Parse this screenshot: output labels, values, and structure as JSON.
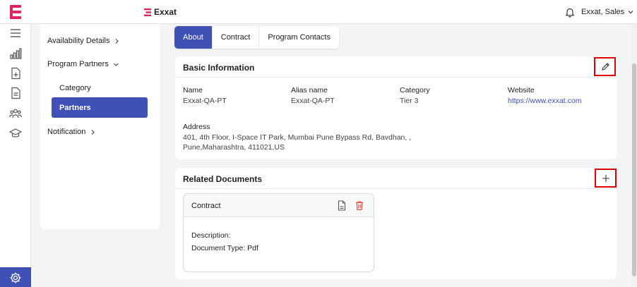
{
  "header": {
    "brand": "Exxat",
    "user": "Exxat, Sales"
  },
  "nav": {
    "availability": "Availability Details",
    "program_partners": "Program Partners",
    "category": "Category",
    "partners": "Partners",
    "notification": "Notification"
  },
  "tabs": [
    "About",
    "Contract",
    "Program Contacts"
  ],
  "basic": {
    "title": "Basic Information",
    "fields": [
      {
        "label": "Name",
        "value": "Exxat-QA-PT"
      },
      {
        "label": "Alias name",
        "value": "Exxat-QA-PT"
      },
      {
        "label": "Category",
        "value": "Tier 3"
      },
      {
        "label": "Website",
        "value": "https://www.exxat.com"
      }
    ],
    "address_label": "Address",
    "address_line1": "401, 4th Floor, I-Space IT Park, Mumbai Pune Bypass Rd, Bavdhan, ,",
    "address_line2": "Pune,Maharashtra, 411021,US"
  },
  "docs": {
    "title": "Related Documents",
    "doc_title": "Contract",
    "description": "Description:",
    "doc_type": "Document Type: Pdf"
  },
  "colors": {
    "accent": "#3f51b5",
    "brand": "#e0245e",
    "highlight": "#e00000",
    "delete": "#e0452f"
  }
}
